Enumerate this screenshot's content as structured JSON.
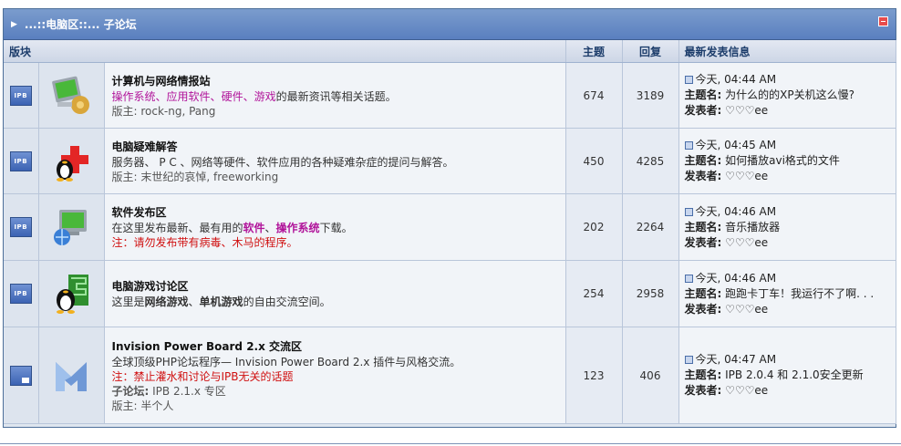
{
  "category": {
    "title": "...::电脑区::... 子论坛"
  },
  "headers": {
    "forum": "版块",
    "topics": "主题",
    "replies": "回复",
    "last_post": "最新发表信息"
  },
  "status_icon_label": "IPB",
  "last_post_labels": {
    "topic": "主题名:",
    "author": "发表者:"
  },
  "forums": [
    {
      "icon": "computer-network-icon",
      "name": "计算机与网络情报站",
      "desc_parts": [
        {
          "text": "操作系统",
          "style": "pink"
        },
        {
          "text": "、",
          "style": "pink"
        },
        {
          "text": "应用软件",
          "style": "pink"
        },
        {
          "text": "、",
          "style": "pink"
        },
        {
          "text": "硬件",
          "style": "pink"
        },
        {
          "text": "、",
          "style": "pink"
        },
        {
          "text": "游戏",
          "style": "pink"
        },
        {
          "text": "的最新资讯等相关话题。",
          "style": "plain"
        }
      ],
      "notice": "",
      "subforum_label": "",
      "subforum": "",
      "moderators": "版主: rock-ng, Pang",
      "topics": "674",
      "replies": "3189",
      "last_time": "今天, 04:44 AM",
      "last_topic": "为什么的的XP关机这么慢?",
      "last_author": "♡♡♡ee"
    },
    {
      "icon": "penguin-cross-icon",
      "name": "电脑疑难解答",
      "desc_parts": [
        {
          "text": "服务器、 P C 、网络等硬件、软件应用的各种疑难杂症的提问与解答。",
          "style": "plain"
        }
      ],
      "notice": "",
      "subforum_label": "",
      "subforum": "",
      "moderators": "版主: 末世纪的哀悼, freeworking",
      "topics": "450",
      "replies": "4285",
      "last_time": "今天, 04:45 AM",
      "last_topic": "如何播放avi格式的文件",
      "last_author": "♡♡♡ee"
    },
    {
      "icon": "software-globe-icon",
      "name": "软件发布区",
      "desc_parts": [
        {
          "text": "在这里发布最新、最有用的",
          "style": "plain"
        },
        {
          "text": "软件",
          "style": "pink-bold"
        },
        {
          "text": "、",
          "style": "plain"
        },
        {
          "text": "操作系统",
          "style": "pink-bold"
        },
        {
          "text": "下载。",
          "style": "plain"
        }
      ],
      "notice": "注：请勿发布带有病毒、木马的程序。",
      "subforum_label": "",
      "subforum": "",
      "moderators": "",
      "topics": "202",
      "replies": "2264",
      "last_time": "今天, 04:46 AM",
      "last_topic": "音乐播放器",
      "last_author": "♡♡♡ee"
    },
    {
      "icon": "penguin-game-icon",
      "name": "电脑游戏讨论区",
      "desc_parts": [
        {
          "text": "这里是",
          "style": "plain"
        },
        {
          "text": "网络游戏",
          "style": "bold"
        },
        {
          "text": "、",
          "style": "plain"
        },
        {
          "text": "单机游戏",
          "style": "bold"
        },
        {
          "text": "的自由交流空间。",
          "style": "plain"
        }
      ],
      "notice": "",
      "subforum_label": "",
      "subforum": "",
      "moderators": "",
      "topics": "254",
      "replies": "2958",
      "last_time": "今天, 04:46 AM",
      "last_topic": "跑跑卡丁车！我运行不了啊. . .",
      "last_author": "♡♡♡ee"
    },
    {
      "icon": "invision-logo-icon",
      "name": "Invision Power Board 2.x 交流区",
      "desc_parts": [
        {
          "text": "全球顶级PHP论坛程序— Invision Power Board 2.x 插件与风格交流。",
          "style": "plain"
        }
      ],
      "notice": "注：禁止灌水和讨论与IPB无关的话题",
      "subforum_label": "子论坛:",
      "subforum": "IPB 2.1.x 专区",
      "moderators": "版主: 半个人",
      "topics": "123",
      "replies": "406",
      "last_time": "今天, 04:47 AM",
      "last_topic": "IPB 2.0.4 和 2.1.0安全更新",
      "last_author": "♡♡♡ee"
    }
  ],
  "colors": {
    "header": "#5a7fbf",
    "pink": "#b1149a",
    "red": "#d01010"
  }
}
